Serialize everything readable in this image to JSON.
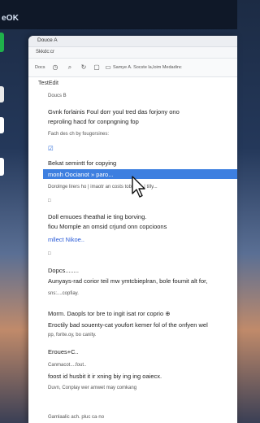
{
  "os": {
    "label": "eOK"
  },
  "dock_colors": [
    "#1fb14b",
    "#eaeaea",
    "#ffffff",
    "#ffffff"
  ],
  "window": {
    "title": "Douce A",
    "address": "Skkdc:cr",
    "toolbar": {
      "docs_label": "Docs",
      "icons": [
        "clock-icon",
        "search-icon",
        "refresh-icon",
        "square-icon",
        "bookmark-icon"
      ],
      "text": "Samye A. Socste la,loim Medadinc"
    },
    "section_title": "TestEdit",
    "lines": [
      {
        "kind": "small",
        "text": "Doucs B"
      },
      {
        "kind": "body",
        "text": "Gvnk forlainis Foul dorr youl tred das forjony ono"
      },
      {
        "kind": "body",
        "text": "reproling hacd for conpngning fop"
      },
      {
        "kind": "small",
        "text": "Fach des ch by fougorsines:"
      },
      {
        "kind": "check",
        "text": "☑"
      },
      {
        "kind": "body",
        "text": "Bekat semintt for copying"
      },
      {
        "kind": "highlight",
        "text": "monh Oocianot » paro..."
      },
      {
        "kind": "small",
        "text": "Dorolnge lirers ho | imaotr an costs tobliles...| tilly..."
      },
      {
        "kind": "small",
        "text": "□"
      },
      {
        "kind": "body",
        "text": "Doll emuoes theathal ie ting borving."
      },
      {
        "kind": "body",
        "text": "fiou Momple an omsid crjund onn copcioons"
      },
      {
        "kind": "link",
        "text": "mllect Nikoe.."
      },
      {
        "kind": "small",
        "text": "□"
      },
      {
        "kind": "body",
        "text": "Dopcs........"
      },
      {
        "kind": "body",
        "text": "Aunyays-rad corior teil mw ymtcbieplran, bole foumit alt for,"
      },
      {
        "kind": "small",
        "text": "sns:....copfiay."
      },
      {
        "kind": "body",
        "text": "Morm. Daopls tor bre to ingit isat ror coprio ⊕"
      },
      {
        "kind": "body",
        "text": "Eroctily bad souenty-cat youfort kemer fol of the onfyen wel"
      },
      {
        "kind": "small",
        "text": "pp, forite.oy, bo canity."
      },
      {
        "kind": "body",
        "text": "Eroues+C.."
      },
      {
        "kind": "small",
        "text": "Canmacot....fout.."
      },
      {
        "kind": "body",
        "text": "foost id husbit it ir xning biy ing ing oaiecx."
      },
      {
        "kind": "small",
        "text": "Duvn, Conplay wer amwet may comkang"
      },
      {
        "kind": "small",
        "text": "Gamlaalic ach. pluc ca·no"
      }
    ]
  }
}
